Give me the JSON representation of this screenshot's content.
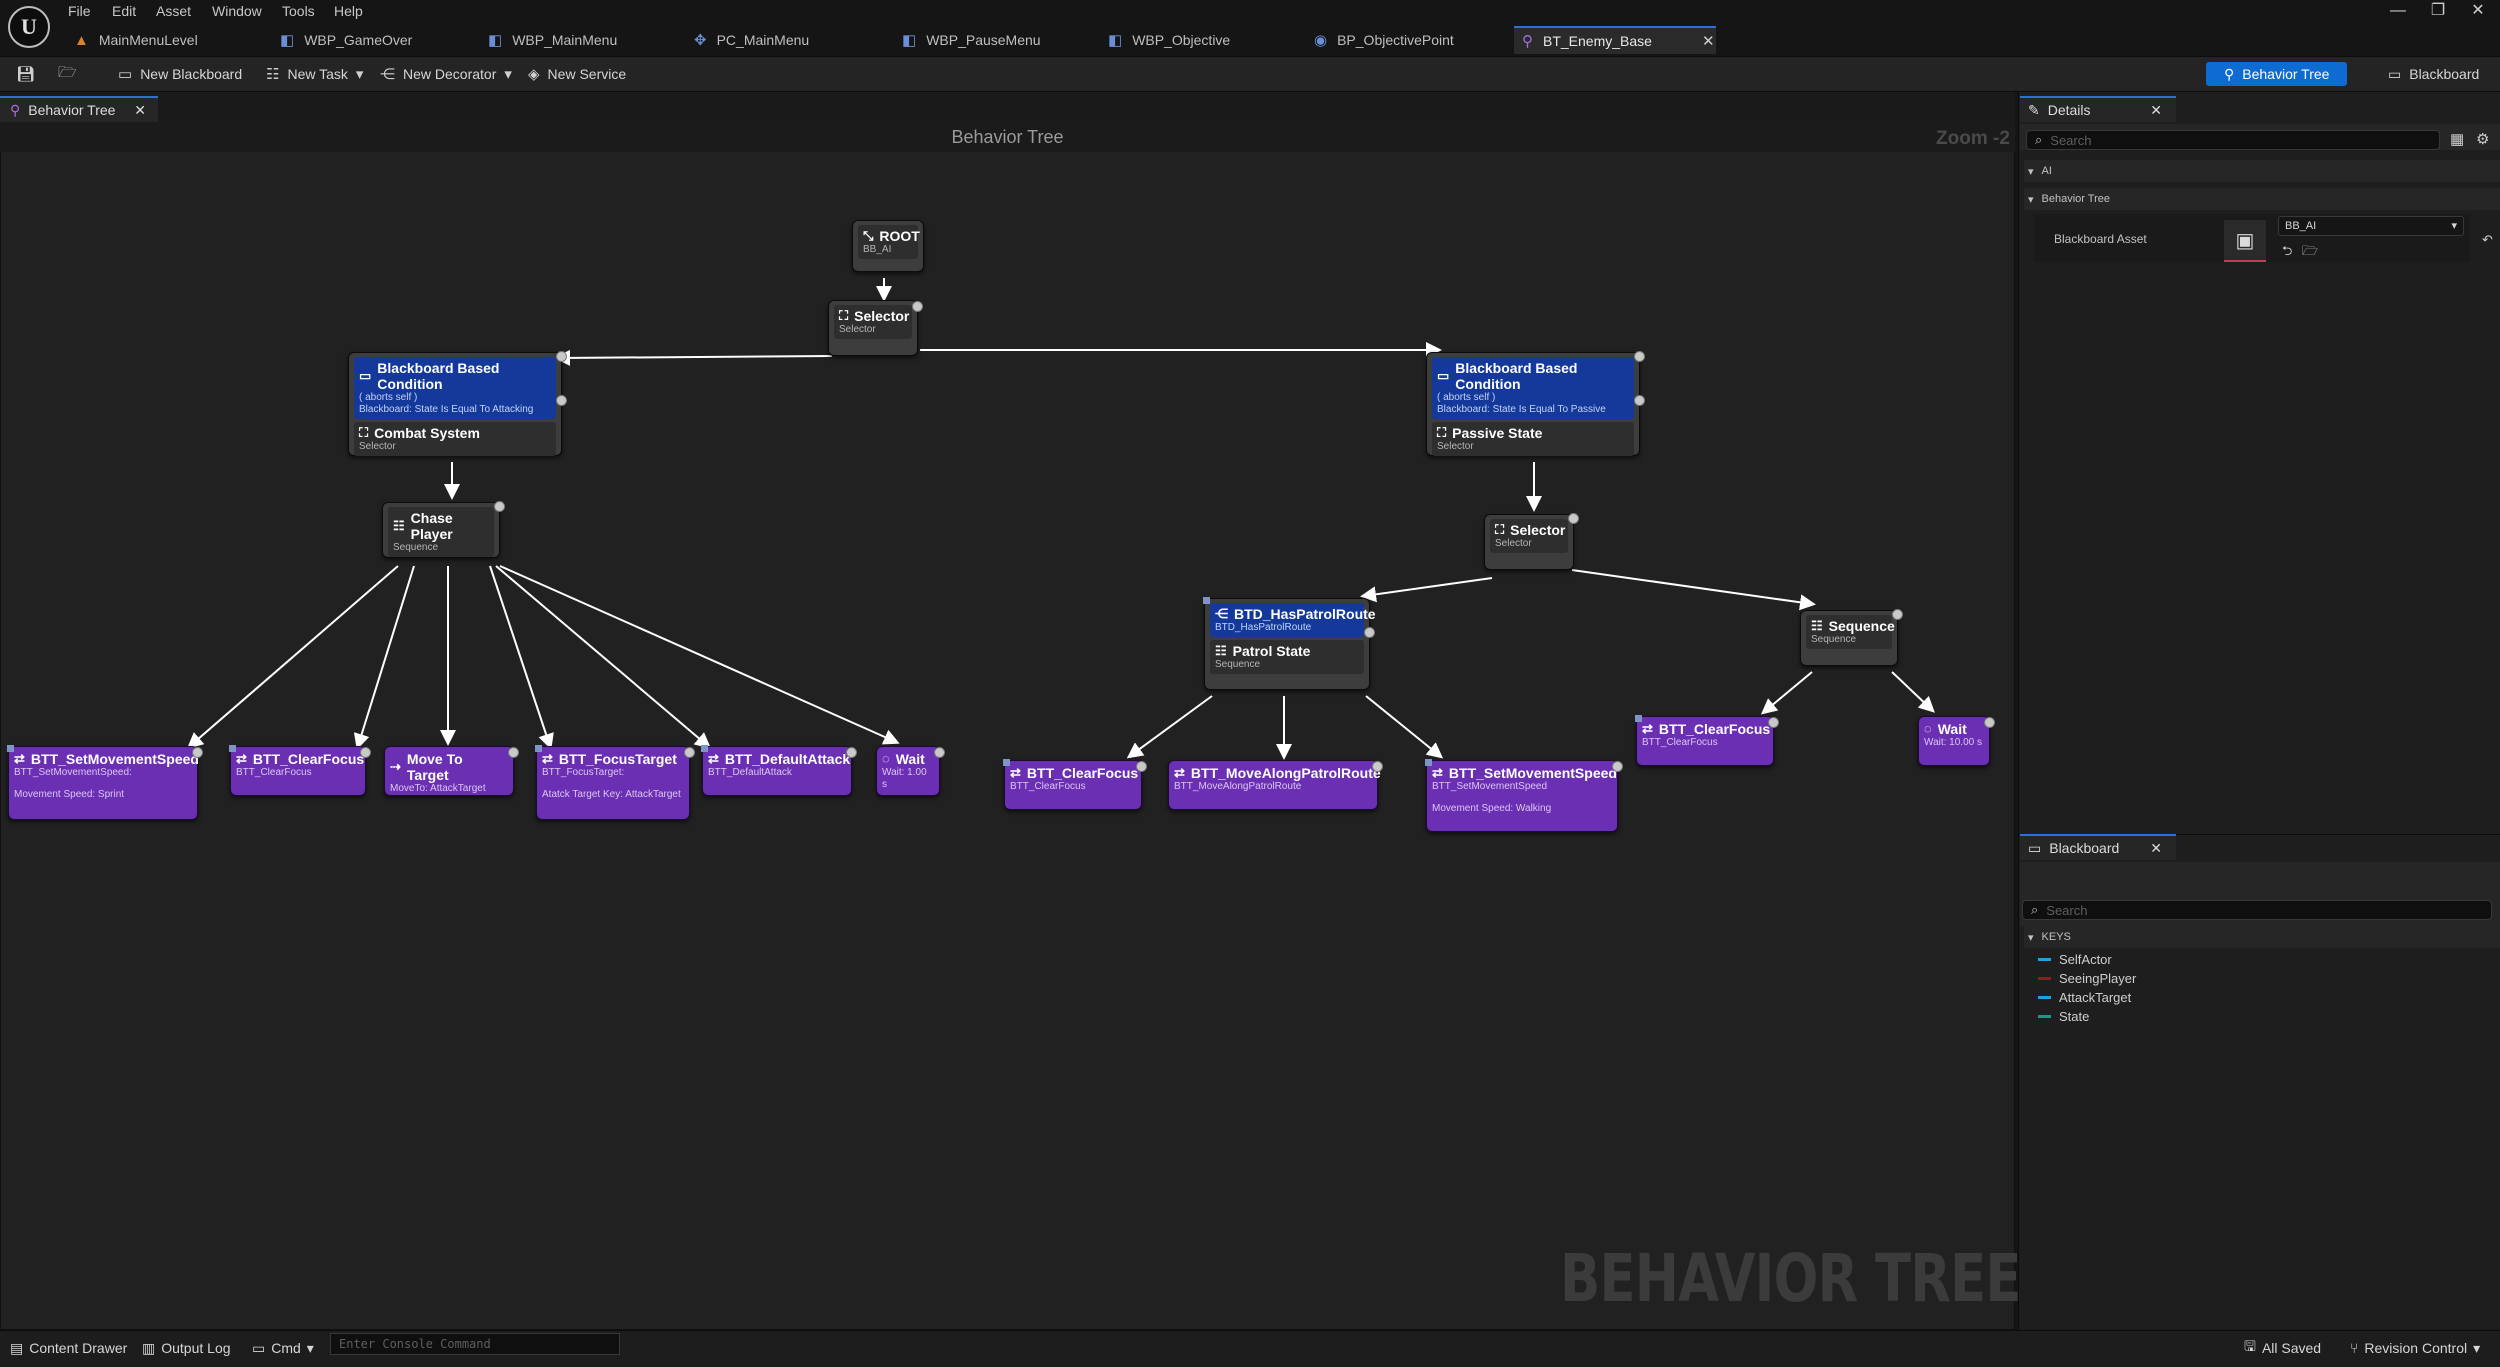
{
  "menu": [
    "File",
    "Edit",
    "Asset",
    "Window",
    "Tools",
    "Help"
  ],
  "tabs": [
    {
      "label": "MainMenuLevel",
      "icon": "level-icon"
    },
    {
      "label": "WBP_GameOver",
      "icon": "widget-blueprint-icon"
    },
    {
      "label": "WBP_MainMenu",
      "icon": "widget-blueprint-icon"
    },
    {
      "label": "PC_MainMenu",
      "icon": "controller-icon"
    },
    {
      "label": "WBP_PauseMenu",
      "icon": "widget-blueprint-icon"
    },
    {
      "label": "WBP_Objective",
      "icon": "widget-blueprint-icon"
    },
    {
      "label": "BP_ObjectivePoint",
      "icon": "actor-blueprint-icon"
    },
    {
      "label": "BT_Enemy_Base",
      "icon": "behavior-tree-icon",
      "active": true
    }
  ],
  "window_controls": {
    "minimize": "—",
    "restore": "❐",
    "close": "✕"
  },
  "toolbar": {
    "new_blackboard": "New Blackboard",
    "new_task": "New Task",
    "new_decorator": "New Decorator",
    "new_service": "New Service",
    "mode_behavior_tree": "Behavior Tree",
    "mode_blackboard": "Blackboard"
  },
  "graph": {
    "tab_label": "Behavior Tree",
    "title": "Behavior Tree",
    "zoom": "Zoom -2",
    "watermark": "BEHAVIOR TREE"
  },
  "nodes": {
    "root": {
      "title": "ROOT",
      "sub": "BB_AI"
    },
    "selector_top": {
      "title": "Selector",
      "sub": "Selector"
    },
    "combat": {
      "decorator_title": "Blackboard Based Condition",
      "decorator_line1": "( aborts self )",
      "decorator_line2": "Blackboard: State Is Equal To Attacking",
      "title": "Combat System",
      "sub": "Selector"
    },
    "passive": {
      "decorator_title": "Blackboard Based Condition",
      "decorator_line1": "( aborts self )",
      "decorator_line2": "Blackboard: State Is Equal To Passive",
      "title": "Passive State",
      "sub": "Selector"
    },
    "chase": {
      "title": "Chase Player",
      "sub": "Sequence"
    },
    "selector_passive": {
      "title": "Selector",
      "sub": "Selector"
    },
    "patrol": {
      "decorator_title": "BTD_HasPatrolRoute",
      "decorator_sub": "BTD_HasPatrolRoute",
      "title": "Patrol State",
      "sub": "Sequence"
    },
    "sequence_right": {
      "title": "Sequence",
      "sub": "Sequence"
    },
    "t_setspeed_sprint": {
      "title": "BTT_SetMovementSpeed",
      "sub": "BTT_SetMovementSpeed:",
      "extra": "Movement Speed: Sprint"
    },
    "t_clearfocus1": {
      "title": "BTT_ClearFocus",
      "sub": "BTT_ClearFocus"
    },
    "t_moveto": {
      "title": "Move To Target",
      "sub": "MoveTo: AttackTarget"
    },
    "t_focustarget": {
      "title": "BTT_FocusTarget",
      "sub": "BTT_FocusTarget:",
      "extra": "Atatck Target Key: AttackTarget"
    },
    "t_defaultattack": {
      "title": "BTT_DefaultAttack",
      "sub": "BTT_DefaultAttack"
    },
    "t_wait1": {
      "title": "Wait",
      "sub": "Wait: 1.00 s"
    },
    "t_clearfocus2": {
      "title": "BTT_ClearFocus",
      "sub": "BTT_ClearFocus"
    },
    "t_movealong": {
      "title": "BTT_MoveAlongPatrolRoute",
      "sub": "BTT_MoveAlongPatrolRoute"
    },
    "t_setspeed_walk": {
      "title": "BTT_SetMovementSpeed",
      "sub": "BTT_SetMovementSpeed",
      "extra": "Movement Speed: Walking"
    },
    "t_clearfocus3": {
      "title": "BTT_ClearFocus",
      "sub": "BTT_ClearFocus"
    },
    "t_wait2": {
      "title": "Wait",
      "sub": "Wait: 10.00 s"
    }
  },
  "details": {
    "tab_label": "Details",
    "search_placeholder": "Search",
    "category_ai": "AI",
    "category_bt": "Behavior Tree",
    "blackboard_asset_label": "Blackboard Asset",
    "blackboard_asset_value": "BB_AI"
  },
  "blackboard": {
    "tab_label": "Blackboard",
    "search_placeholder": "Search",
    "keys_header": "KEYS",
    "keys": [
      {
        "name": "SelfActor",
        "color": "#1ea0e6"
      },
      {
        "name": "SeeingPlayer",
        "color": "#8b1d1d"
      },
      {
        "name": "AttackTarget",
        "color": "#1ea0e6"
      },
      {
        "name": "State",
        "color": "#159a8c"
      }
    ]
  },
  "statusbar": {
    "content_drawer": "Content Drawer",
    "output_log": "Output Log",
    "cmd": "Cmd",
    "console_placeholder": "Enter Console Command",
    "all_saved": "All Saved",
    "revision_control": "Revision Control"
  },
  "colors": {
    "accent": "#2e6fd6",
    "task": "#6b2fb4",
    "decorator": "#15399a",
    "node": "#3d3d3d"
  }
}
